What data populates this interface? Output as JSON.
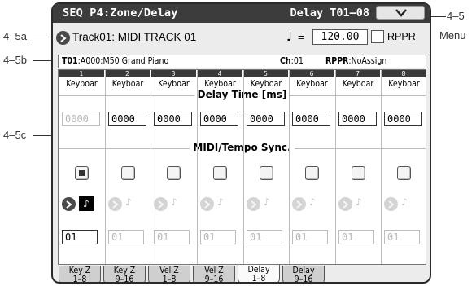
{
  "callouts": {
    "menu_ref": "4–5",
    "menu_word": "Menu",
    "track_ref": "4–5a",
    "info_ref": "4–5b",
    "grid_ref": "4–5c"
  },
  "header": {
    "title": "SEQ P4:Zone/Delay",
    "range": "Delay T01–08",
    "menu_icon": "chevron-down-icon"
  },
  "track_row": {
    "track_name": "Track01: MIDI TRACK 01",
    "tempo_symbol": "♩",
    "tempo_eq": "=",
    "tempo_value": "120.00",
    "rppr_label": "RPPR",
    "rppr_checked": false
  },
  "info": {
    "track_bold": "T01",
    "track_program": ":A000:M50 Grand Piano",
    "ch_label": "Ch",
    "ch_value": ":01",
    "rppr_label": "RPPR",
    "rppr_value": ":NoAssign"
  },
  "grid": {
    "columns": [
      "1",
      "2",
      "3",
      "4",
      "5",
      "6",
      "7",
      "8"
    ],
    "keyboard_labels": [
      "Keyboar",
      "Keyboar",
      "Keyboar",
      "Keyboar",
      "Keyboar",
      "Keyboar",
      "Keyboar",
      "Keyboar"
    ],
    "delay_title": "Delay Time [ms]",
    "delay_values": [
      "0000",
      "0000",
      "0000",
      "0000",
      "0000",
      "0000",
      "0000",
      "0000"
    ],
    "sync_title": "MIDI/Tempo Sync.",
    "sync_checked": [
      true,
      false,
      false,
      false,
      false,
      false,
      false,
      false
    ],
    "note_symbols": [
      "♪",
      "♪",
      "♪",
      "♪",
      "♪",
      "♪",
      "♪",
      "♪"
    ],
    "track_values": [
      "01",
      "01",
      "01",
      "01",
      "01",
      "01",
      "01",
      "01"
    ]
  },
  "tabs": [
    {
      "l1": "Key Z",
      "l2": "1–8"
    },
    {
      "l1": "Key Z",
      "l2": "9–16"
    },
    {
      "l1": "Vel Z",
      "l2": "1–8"
    },
    {
      "l1": "Vel Z",
      "l2": "9–16"
    },
    {
      "l1": "Delay",
      "l2": "1–8"
    },
    {
      "l1": "Delay",
      "l2": "9–16"
    }
  ],
  "active_tab": 4
}
